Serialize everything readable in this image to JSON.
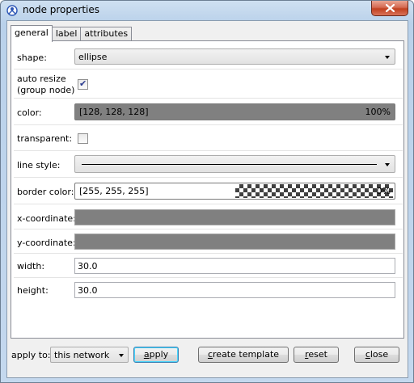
{
  "window": {
    "title": "node properties"
  },
  "tabs": [
    {
      "label": "general",
      "active": true
    },
    {
      "label": "label",
      "active": false
    },
    {
      "label": "attributes",
      "active": false
    }
  ],
  "fields": {
    "shape": {
      "label": "shape:",
      "value": "ellipse"
    },
    "auto_resize": {
      "label_line1": "auto resize",
      "label_line2": "(group node)",
      "checked": true
    },
    "color": {
      "label": "color:",
      "value": "[128, 128, 128]",
      "opacity": "100%",
      "swatch": "#808080"
    },
    "transparent": {
      "label": "transparent:",
      "checked": false
    },
    "line_style": {
      "label": "line style:",
      "value": "solid"
    },
    "border_color": {
      "label": "border color:",
      "value": "[255, 255, 255]",
      "opacity": "0%"
    },
    "x_coordinate": {
      "label": "x-coordinate:",
      "value": ""
    },
    "y_coordinate": {
      "label": "y-coordinate:",
      "value": ""
    },
    "width": {
      "label": "width:",
      "value": "30.0"
    },
    "height": {
      "label": "height:",
      "value": "30.0"
    }
  },
  "footer": {
    "apply_to_label": "apply to:",
    "apply_to_value": "this network",
    "apply": {
      "mnemonic": "a",
      "rest": "pply"
    },
    "create_template": {
      "mnemonic": "c",
      "rest": "reate template"
    },
    "reset": {
      "mnemonic": "r",
      "rest": "eset"
    },
    "close": {
      "mnemonic": "c",
      "rest": "lose"
    }
  },
  "icons": {
    "app": "node-app-icon",
    "close": "close-icon",
    "dropdown": "chevron-down-icon",
    "check": "checkmark-icon"
  }
}
